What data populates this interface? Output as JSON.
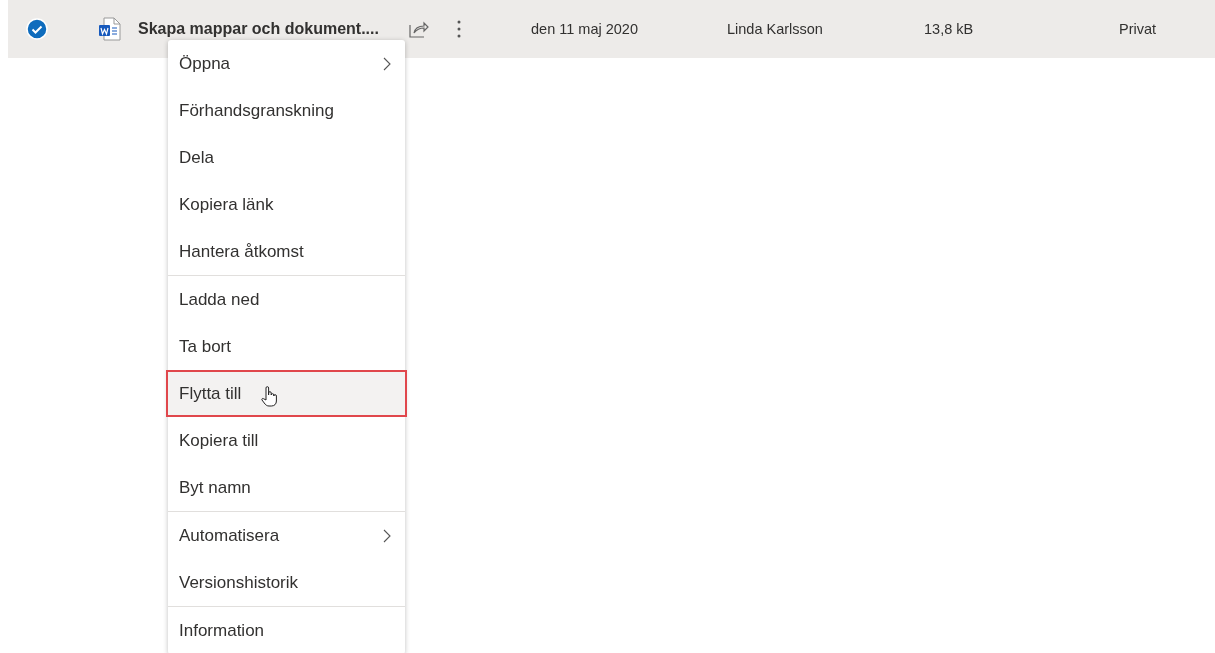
{
  "file_row": {
    "selected": true,
    "name": "Skapa mappar och dokument....",
    "modified": "den 11 maj 2020",
    "modified_by": "Linda Karlsson",
    "size": "13,8 kB",
    "sharing": "Privat"
  },
  "context_menu": {
    "items": [
      {
        "label": "Öppna",
        "submenu": true,
        "selected": false,
        "divider_after": false
      },
      {
        "label": "Förhandsgranskning",
        "submenu": false,
        "selected": false,
        "divider_after": false
      },
      {
        "label": "Dela",
        "submenu": false,
        "selected": false,
        "divider_after": false
      },
      {
        "label": "Kopiera länk",
        "submenu": false,
        "selected": false,
        "divider_after": false
      },
      {
        "label": "Hantera åtkomst",
        "submenu": false,
        "selected": false,
        "divider_after": true
      },
      {
        "label": "Ladda ned",
        "submenu": false,
        "selected": false,
        "divider_after": false
      },
      {
        "label": "Ta bort",
        "submenu": false,
        "selected": false,
        "divider_after": false
      },
      {
        "label": "Flytta till",
        "submenu": false,
        "selected": true,
        "divider_after": false
      },
      {
        "label": "Kopiera till",
        "submenu": false,
        "selected": false,
        "divider_after": false
      },
      {
        "label": "Byt namn",
        "submenu": false,
        "selected": false,
        "divider_after": true
      },
      {
        "label": "Automatisera",
        "submenu": true,
        "selected": false,
        "divider_after": false
      },
      {
        "label": "Versionshistorik",
        "submenu": false,
        "selected": false,
        "divider_after": true
      },
      {
        "label": "Information",
        "submenu": false,
        "selected": false,
        "divider_after": false
      }
    ]
  }
}
